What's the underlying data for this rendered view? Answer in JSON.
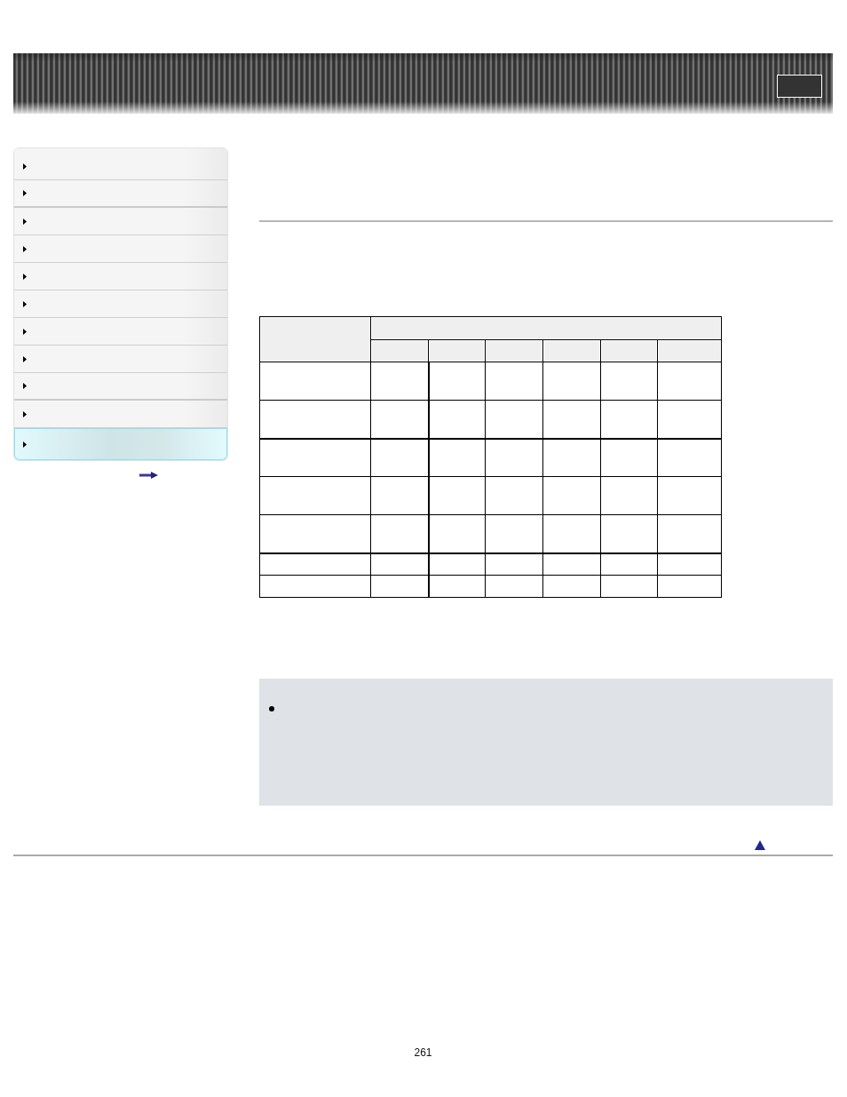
{
  "sidebar": {
    "items": [
      {
        "selected": false
      },
      {
        "selected": false
      },
      {
        "selected": false
      },
      {
        "selected": false
      },
      {
        "selected": false
      },
      {
        "selected": false
      },
      {
        "selected": false
      },
      {
        "selected": false
      },
      {
        "selected": false
      },
      {
        "selected": false
      },
      {
        "selected": true
      }
    ]
  },
  "table": {
    "groups": [
      {
        "rows": [
          {
            "kind": "tall"
          },
          {
            "kind": "tall"
          }
        ]
      },
      {
        "rows": [
          {
            "kind": "tall"
          },
          {
            "kind": "tall"
          },
          {
            "kind": "tall"
          }
        ]
      },
      {
        "rows": [
          {
            "kind": "short"
          },
          {
            "kind": "short"
          }
        ]
      }
    ]
  },
  "page_number": "261"
}
